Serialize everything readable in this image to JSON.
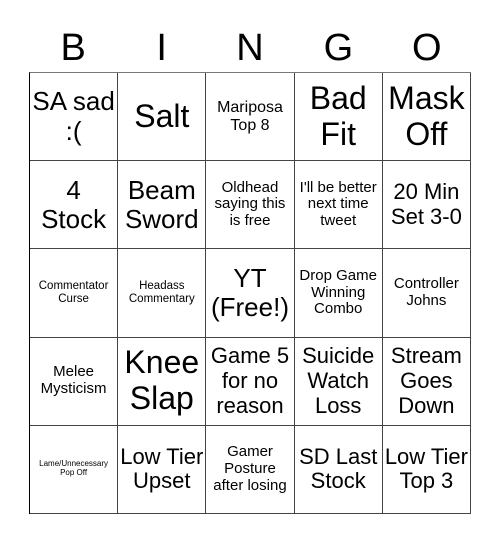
{
  "header": [
    "B",
    "I",
    "N",
    "G",
    "O"
  ],
  "cells": [
    [
      "SA sad :(",
      "Salt",
      "Mariposa Top 8",
      "Bad Fit",
      "Mask Off"
    ],
    [
      "4 Stock",
      "Beam Sword",
      "Oldhead saying this is free",
      "I'll be better next time tweet",
      "20 Min Set 3-0"
    ],
    [
      "Commentator Curse",
      "Headass Commentary",
      "YT (Free!)",
      "Drop Game Winning Combo",
      "Controller Johns"
    ],
    [
      "Melee Mysticism",
      "Knee Slap",
      "Game 5 for no reason",
      "Suicide Watch Loss",
      "Stream Goes Down"
    ],
    [
      "Lame/Unnecessary Pop Off",
      "Low Tier Upset",
      "Gamer Posture after losing",
      "SD Last Stock",
      "Low Tier Top 3"
    ]
  ]
}
